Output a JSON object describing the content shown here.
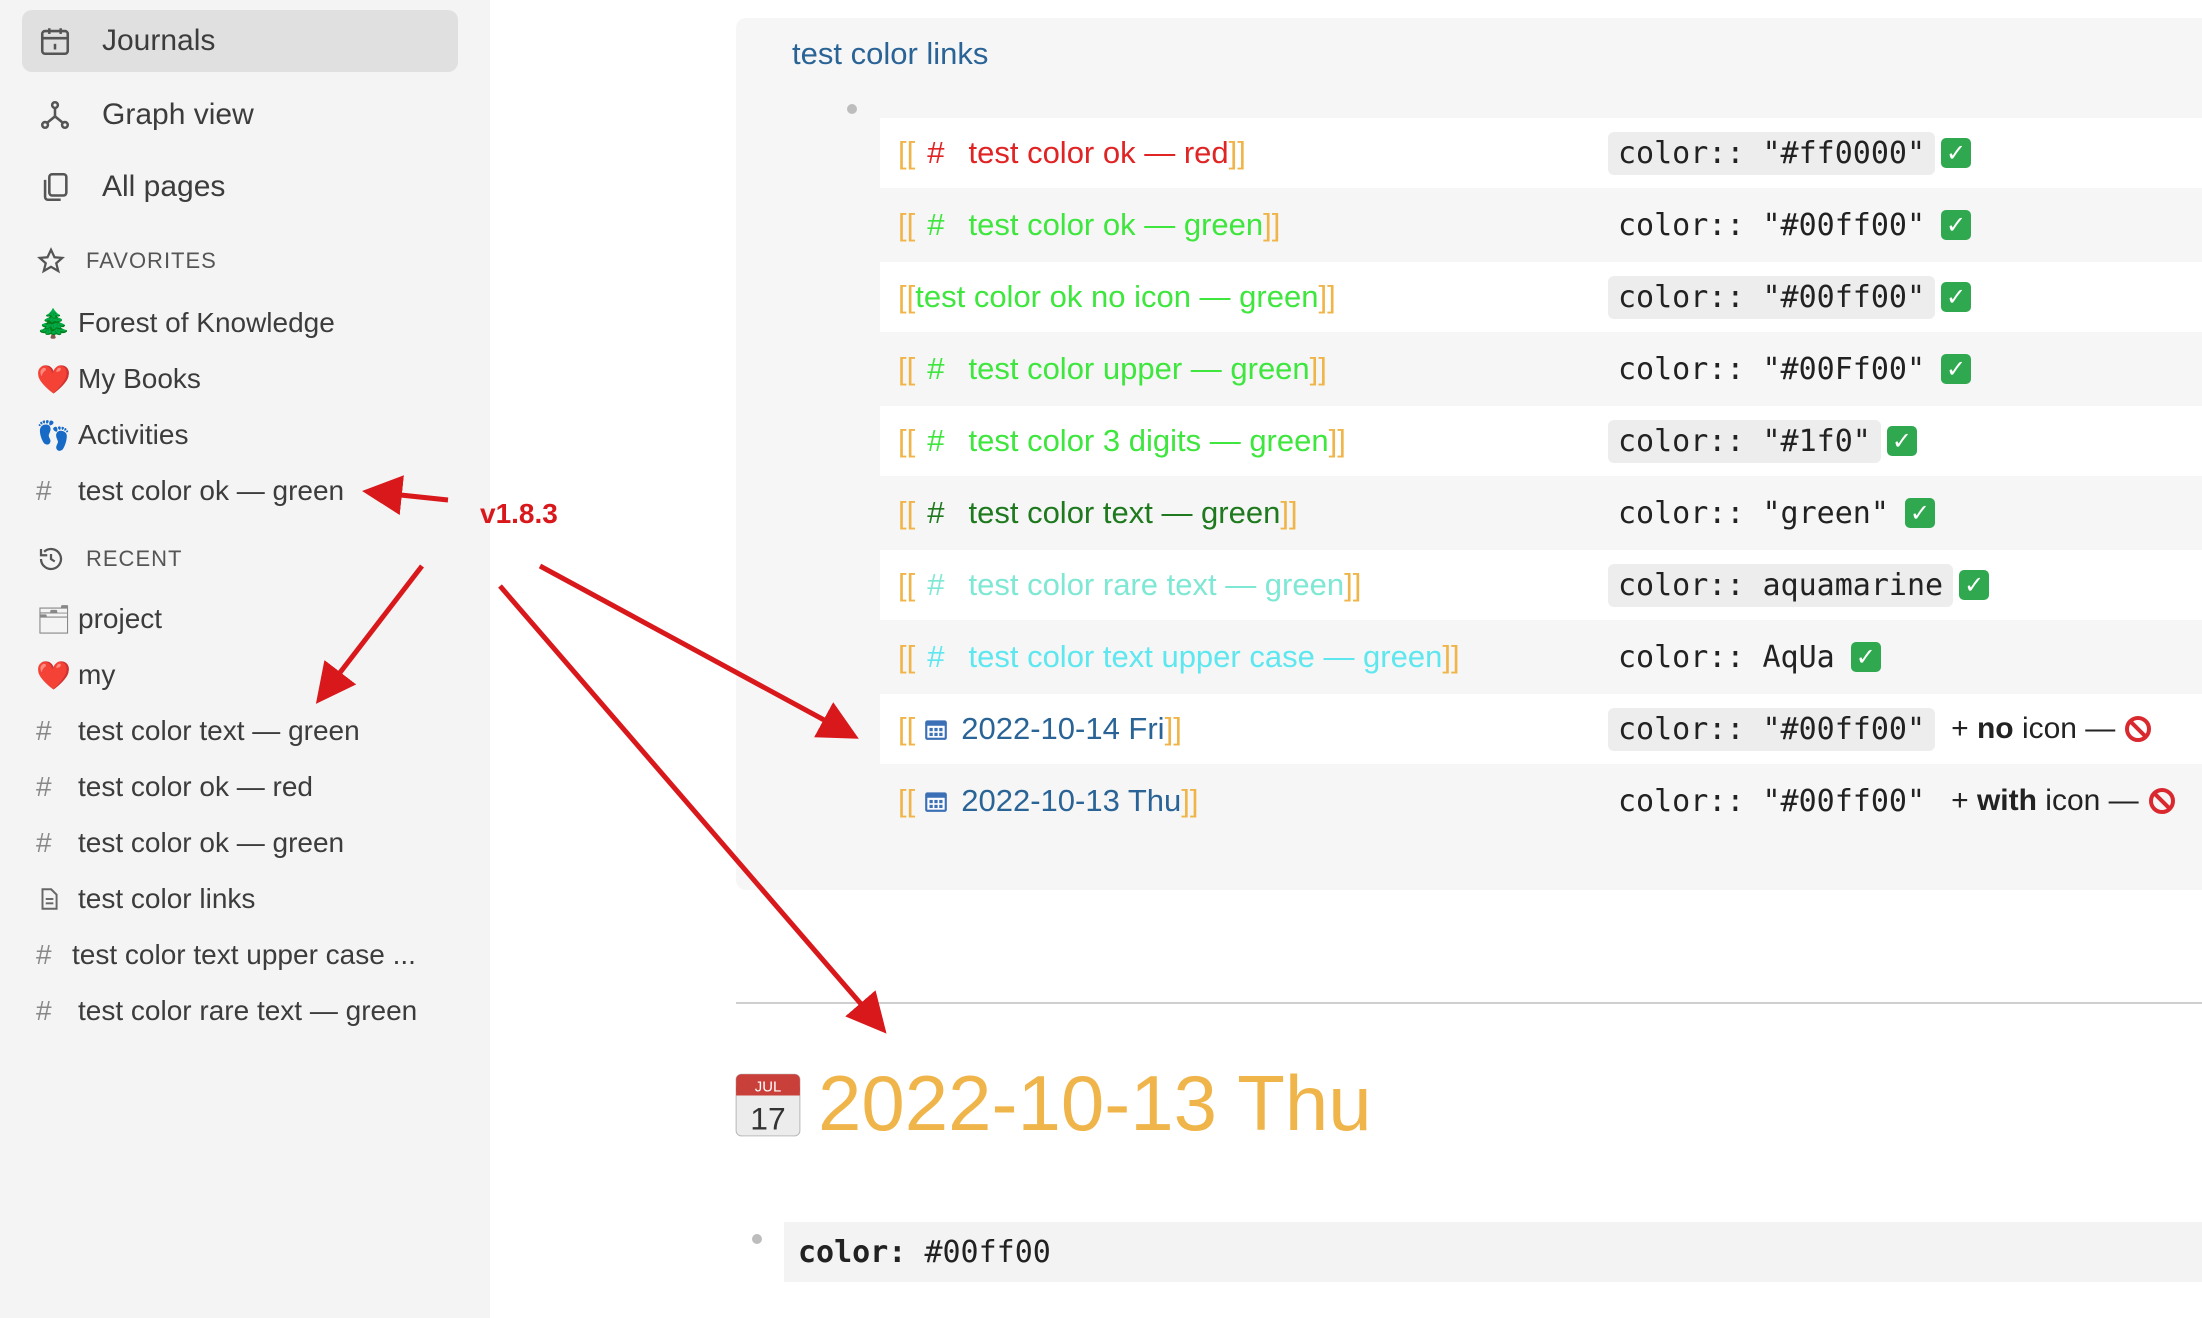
{
  "sidebar": {
    "nav": [
      {
        "label": "Journals",
        "icon": "calendar-icon"
      },
      {
        "label": "Graph view",
        "icon": "graph-icon"
      },
      {
        "label": "All pages",
        "icon": "pages-icon"
      }
    ],
    "favorites_header": "FAVORITES",
    "favorites": [
      {
        "label": "Forest of Knowledge",
        "icon": "🌲"
      },
      {
        "label": "My Books",
        "icon": "❤️"
      },
      {
        "label": "Activities",
        "icon": "👣"
      },
      {
        "label": "test color ok — green",
        "icon": "#"
      }
    ],
    "recent_header": "RECENT",
    "recent": [
      {
        "label": "project",
        "icon": "🗂"
      },
      {
        "label": "my",
        "icon": "❤️"
      },
      {
        "label": "test color text — green",
        "icon": "#"
      },
      {
        "label": "test color ok — red",
        "icon": "#"
      },
      {
        "label": "test color ok — green",
        "icon": "#"
      },
      {
        "label": "test color links",
        "icon": "document-icon"
      },
      {
        "label": "test color text upper case ...",
        "icon": "#"
      },
      {
        "label": "test color rare text — green",
        "icon": "#"
      }
    ]
  },
  "annotation": {
    "version_label": "v1.8.3",
    "color": "#d9181c"
  },
  "page": {
    "block_title": "test color links",
    "rows": [
      {
        "open": "[[",
        "hash": "#",
        "text": "test color ok — red",
        "close": "]]",
        "color": "#e02424",
        "prop_key": "color::",
        "prop_val": "\"#ff0000\"",
        "check": "✓"
      },
      {
        "open": "[[",
        "hash": "#",
        "text": "test color ok — green",
        "close": "]]",
        "color": "#3ee63e",
        "prop_key": "color::",
        "prop_val": "\"#00ff00\"",
        "check": "✓"
      },
      {
        "open": "[[",
        "hash": "",
        "text": "test color ok no icon — green",
        "close": "]]",
        "color": "#3ee63e",
        "prop_key": "color::",
        "prop_val": "\"#00ff00\"",
        "check": "✓"
      },
      {
        "open": "[[",
        "hash": "#",
        "text": "test color upper — green",
        "close": "]]",
        "color": "#3ee63e",
        "prop_key": "color::",
        "prop_val": "\"#00Ff00\"",
        "check": "✓"
      },
      {
        "open": "[[",
        "hash": "#",
        "text": "test color 3 digits — green",
        "close": "]]",
        "color": "#3ee63e",
        "prop_key": "color::",
        "prop_val": "\"#1f0\"",
        "check": "✓"
      },
      {
        "open": "[[",
        "hash": "#",
        "text": "test color text — green",
        "close": "]]",
        "color": "#1f7a1f",
        "prop_key": "color::",
        "prop_val": "\"green\"",
        "check": "✓"
      },
      {
        "open": "[[",
        "hash": "#",
        "text": "test color rare text — green",
        "close": "]]",
        "color": "#7fe8d4",
        "prop_key": "color::",
        "prop_val": "aquamarine",
        "check": "✓"
      },
      {
        "open": "[[",
        "hash": "#",
        "text": "test color text upper case — green",
        "close": "]]",
        "color": "#5ee7ef",
        "prop_key": "color::",
        "prop_val": "AqUa",
        "check": "✓"
      },
      {
        "open": "[[",
        "hash": "",
        "text": "2022-10-14 Fri",
        "close": "]]",
        "color": "#2a6496",
        "prop_key": "color::",
        "prop_val": "\"#00ff00\"",
        "note_pre": "+",
        "note_bold": "no",
        "note_post": "icon —"
      },
      {
        "open": "[[",
        "hash": "",
        "text": "2022-10-13 Thu",
        "close": "]]",
        "color": "#2a6496",
        "prop_key": "color::",
        "prop_val": "\"#00ff00\"",
        "note_pre": "+",
        "note_bold": "with",
        "note_post": "icon —"
      }
    ],
    "journal_title": "2022-10-13 Thu",
    "journal_cal_month": "JUL",
    "journal_cal_day": "17",
    "journal_prop_key": "color:",
    "journal_prop_val": "#00ff00"
  },
  "colors": {
    "accent_link": "#2a6496",
    "bracket": "#f0b54a",
    "journal_title": "#f0b54a"
  }
}
